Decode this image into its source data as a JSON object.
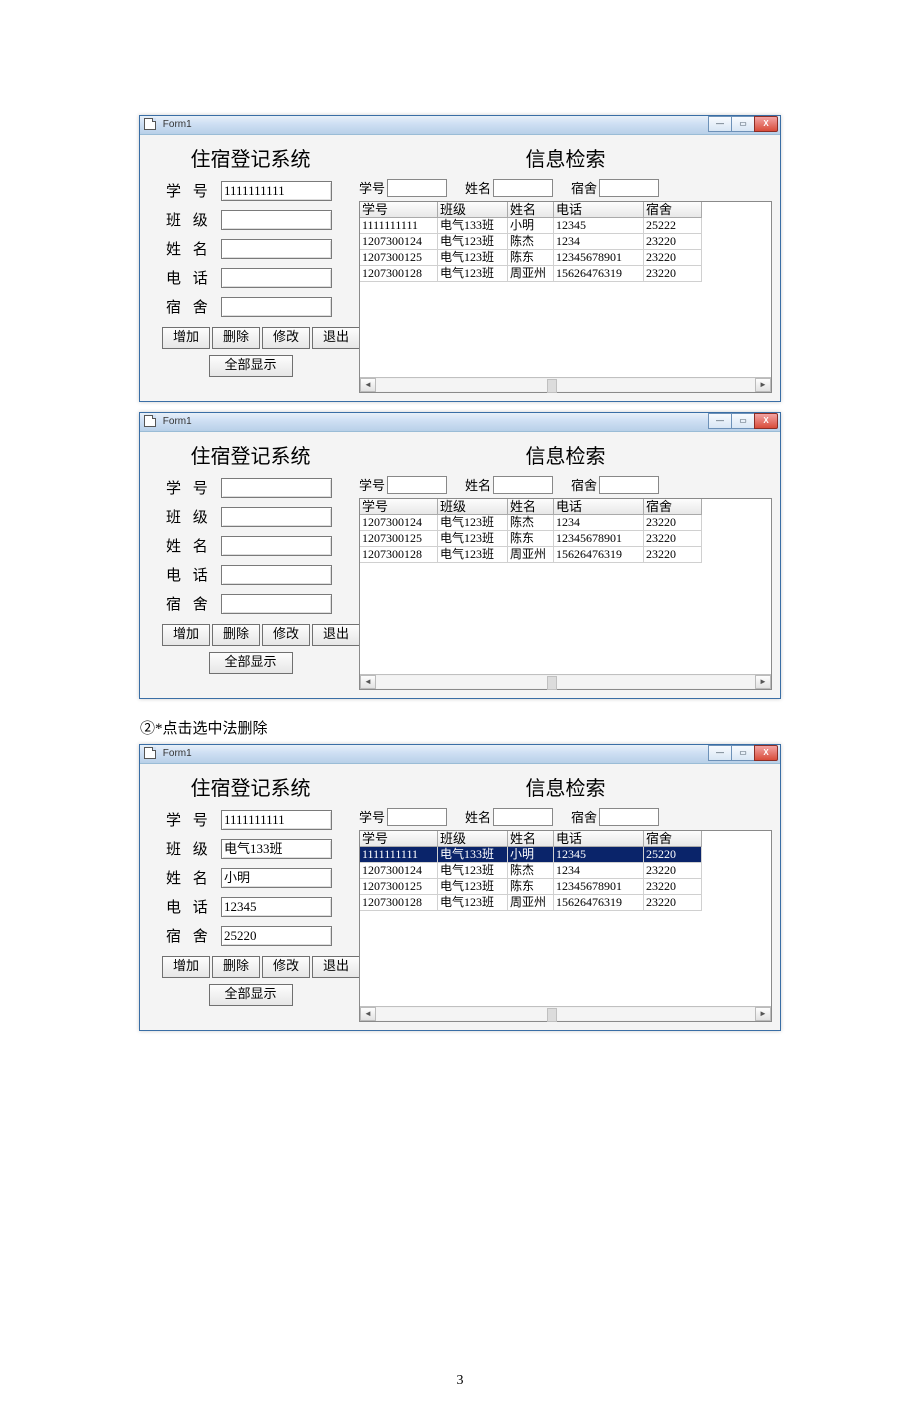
{
  "page_number": "3",
  "caption_line": "②*点击选中法删除",
  "window_title": "Form1",
  "winbtns": {
    "min": "—",
    "max": "▭",
    "close": "X"
  },
  "left_panel_title": "住宿登记系统",
  "right_panel_title": "信息检索",
  "search_labels": {
    "id": "学号",
    "name": "姓名",
    "dorm": "宿舍"
  },
  "form_labels": {
    "id": "学 号",
    "class": "班 级",
    "name": "姓 名",
    "phone": "电 话",
    "dorm": "宿 舍"
  },
  "buttons": {
    "add": "增加",
    "del": "删除",
    "edit": "修改",
    "exit": "退出",
    "showall": "全部显示"
  },
  "grid_headers": [
    "学号",
    "班级",
    "姓名",
    "电话",
    "宿舍"
  ],
  "win1": {
    "form": {
      "id": "1111111111",
      "class": "",
      "name": "",
      "phone": "",
      "dorm": ""
    },
    "rows": [
      [
        "1111111111",
        "电气133班",
        "小明",
        "12345",
        "25222"
      ],
      [
        "1207300124",
        "电气123班",
        "陈杰",
        "1234",
        "23220"
      ],
      [
        "1207300125",
        "电气123班",
        "陈东",
        "12345678901",
        "23220"
      ],
      [
        "1207300128",
        "电气123班",
        "周亚州",
        "15626476319",
        "23220"
      ]
    ],
    "selected": -1
  },
  "win2": {
    "form": {
      "id": "",
      "class": "",
      "name": "",
      "phone": "",
      "dorm": ""
    },
    "rows": [
      [
        "1207300124",
        "电气123班",
        "陈杰",
        "1234",
        "23220"
      ],
      [
        "1207300125",
        "电气123班",
        "陈东",
        "12345678901",
        "23220"
      ],
      [
        "1207300128",
        "电气123班",
        "周亚州",
        "15626476319",
        "23220"
      ]
    ],
    "selected": -1
  },
  "win3": {
    "form": {
      "id": "1111111111",
      "class": "电气133班",
      "name": "小明",
      "phone": "12345",
      "dorm": "25220"
    },
    "rows": [
      [
        "1111111111",
        "电气133班",
        "小明",
        "12345",
        "25220"
      ],
      [
        "1207300124",
        "电气123班",
        "陈杰",
        "1234",
        "23220"
      ],
      [
        "1207300125",
        "电气123班",
        "陈东",
        "12345678901",
        "23220"
      ],
      [
        "1207300128",
        "电气123班",
        "周亚州",
        "15626476319",
        "23220"
      ]
    ],
    "selected": 0
  }
}
